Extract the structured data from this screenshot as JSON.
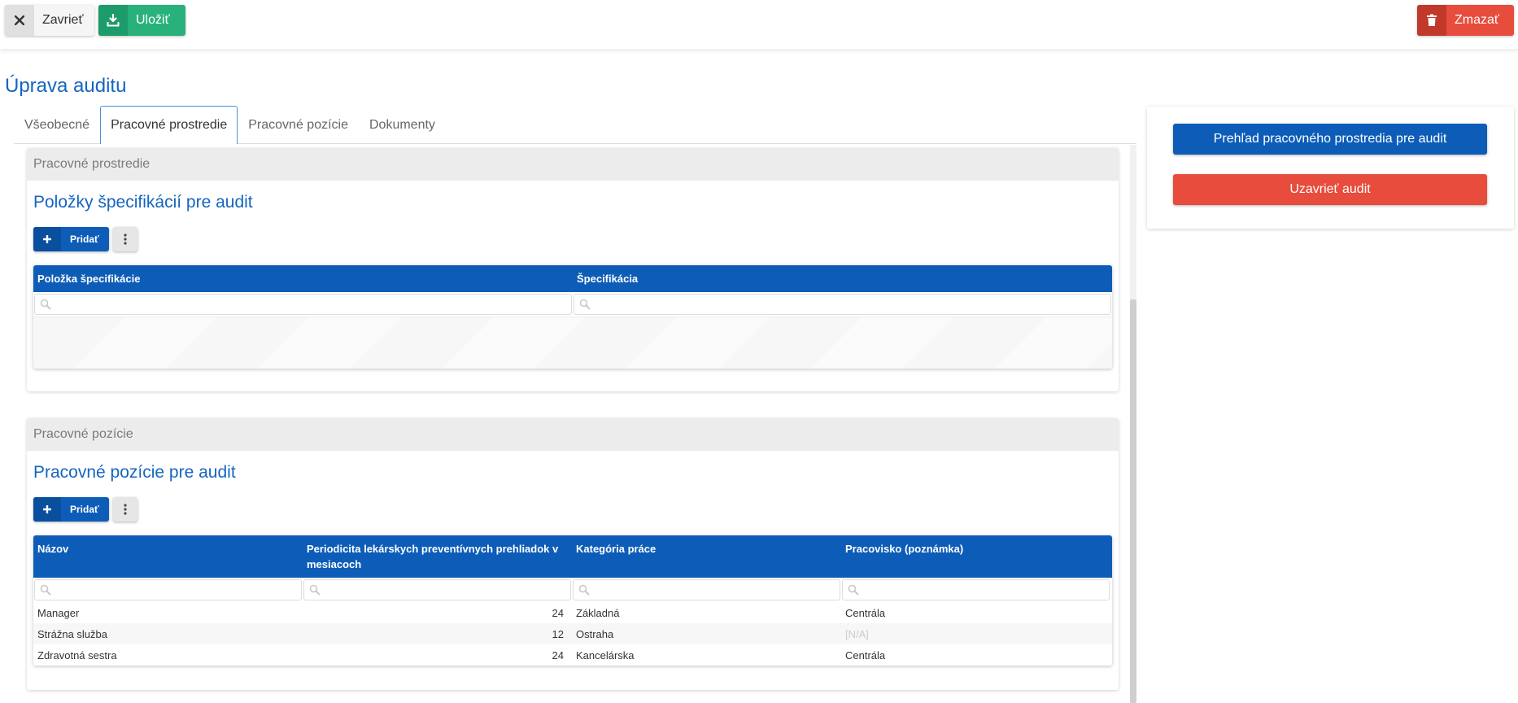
{
  "toolbar": {
    "close_label": "Zavrieť",
    "save_label": "Uložiť",
    "delete_label": "Zmazať"
  },
  "page": {
    "title": "Úprava auditu"
  },
  "tabs": [
    {
      "label": "Všeobecné"
    },
    {
      "label": "Pracovné prostredie"
    },
    {
      "label": "Pracovné pozície"
    },
    {
      "label": "Dokumenty"
    }
  ],
  "active_tab": "Pracovné prostredie",
  "section1": {
    "header": "Pracovné prostredie",
    "title": "Položky špecifikácií pre audit",
    "add_label": "Pridať",
    "columns": [
      "Položka špecifikácie",
      "Špecifikácia"
    ]
  },
  "section2": {
    "header": "Pracovné pozície",
    "title": "Pracovné pozície pre audit",
    "add_label": "Pridať",
    "columns": [
      "Názov",
      "Periodicita lekárskych preventívnych prehliadok v mesiacoch",
      "Kategória práce",
      "Pracovisko (poznámka)"
    ],
    "rows": [
      {
        "name": "Manager",
        "period": "24",
        "category": "Základná",
        "workplace": "Centrála"
      },
      {
        "name": "Strážna služba",
        "period": "12",
        "category": "Ostraha",
        "workplace": "[N/A]"
      },
      {
        "name": "Zdravotná sestra",
        "period": "24",
        "category": "Kancelárska",
        "workplace": "Centrála"
      }
    ]
  },
  "side": {
    "overview_label": "Prehľad pracovného prostredia pre audit",
    "close_audit_label": "Uzavrieť audit"
  },
  "colors": {
    "primary": "#0d5db8",
    "success": "#29b17c",
    "danger": "#e74c3c",
    "title": "#1565c0"
  },
  "icons": {
    "close": "close-icon",
    "save": "download-icon",
    "delete": "trash-icon",
    "add": "plus-icon",
    "more": "more-vertical-icon",
    "filter": "search-icon"
  }
}
